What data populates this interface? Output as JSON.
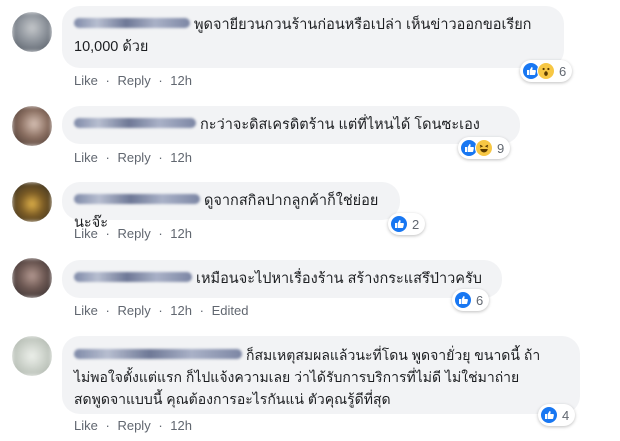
{
  "colors": {
    "like_blue": "#1877f2",
    "bubble_bg": "#f2f3f5",
    "meta_gray": "#616770",
    "emoji_yellow": "#f7c744"
  },
  "actions": {
    "like": "Like",
    "reply": "Reply",
    "dot": "·"
  },
  "comments": [
    {
      "lines": [
        "พูดจายียวนกวนร้านก่อนหรือเปล่า เห็นข่าวออกขอเรียก",
        "10,000 ด้วย"
      ],
      "time": "12h",
      "edited": "",
      "reactions": [
        "like-icon",
        "wow-icon"
      ],
      "reaction_count": "6"
    },
    {
      "lines": [
        "กะว่าจะดิสเครดิตร้าน แต่ที่ไหนได้ โดนซะเอง"
      ],
      "time": "12h",
      "edited": "",
      "reactions": [
        "like-icon",
        "haha-icon"
      ],
      "reaction_count": "9"
    },
    {
      "lines": [
        "ดูจากสกิลปากลูกค้าก็ใช่ย่อยนะจ๊ะ"
      ],
      "time": "12h",
      "edited": "",
      "reactions": [
        "like-icon"
      ],
      "reaction_count": "2"
    },
    {
      "lines": [
        "เหมือนจะไปหาเรื่องร้าน สร้างกระแสรึป่าวครับ"
      ],
      "time": "12h",
      "edited": "Edited",
      "reactions": [
        "like-icon"
      ],
      "reaction_count": "6"
    },
    {
      "lines": [
        "ก็สมเหตุสมผลแล้วนะที่โดน พูดจายั่วยุ ขนาดนี้ ถ้า",
        "ไม่พอใจตั้งแต่แรก ก็ไปแจ้งความเลย ว่าได้รับการบริการที่ไม่ดี ไม่ใช่มาถ่าย",
        "สดพูดจาแบบนี้ คุณต้องการอะไรกันแน่ ตัวคุณรู้ดีที่สุด"
      ],
      "time": "12h",
      "edited": "",
      "reactions": [
        "like-icon"
      ],
      "reaction_count": "4"
    }
  ]
}
